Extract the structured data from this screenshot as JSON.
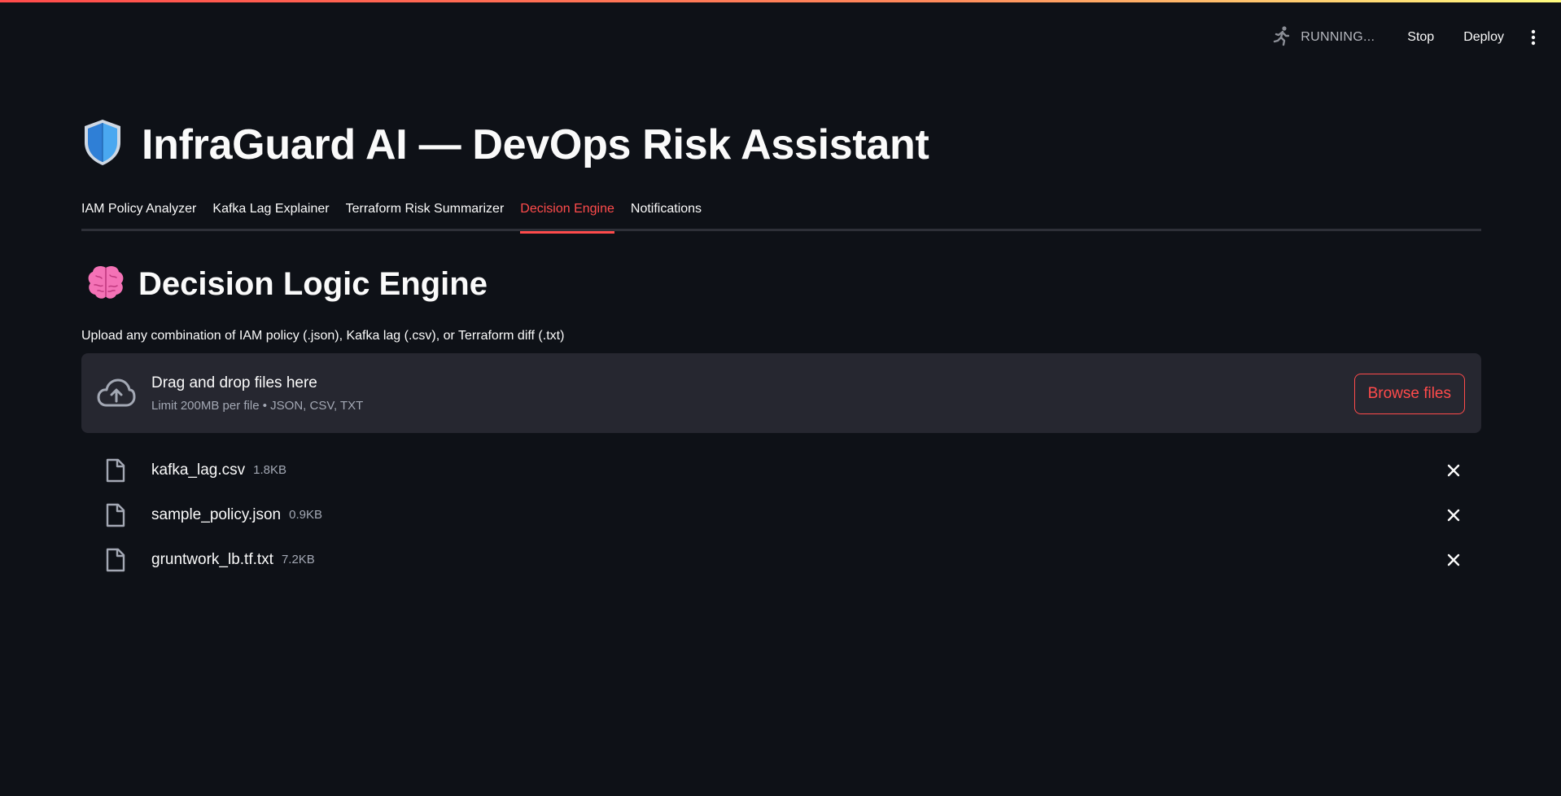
{
  "toolbar": {
    "status": "RUNNING...",
    "stop_label": "Stop",
    "deploy_label": "Deploy",
    "status_icon": "running-person-icon",
    "menu_icon": "vertical-dots-icon"
  },
  "app": {
    "title_icon": "shield-icon",
    "title": "InfraGuard AI — DevOps Risk Assistant"
  },
  "tabs": [
    {
      "label": "IAM Policy Analyzer",
      "active": false
    },
    {
      "label": "Kafka Lag Explainer",
      "active": false
    },
    {
      "label": "Terraform Risk Summarizer",
      "active": false
    },
    {
      "label": "Decision Engine",
      "active": true
    },
    {
      "label": "Notifications",
      "active": false
    }
  ],
  "section": {
    "icon": "brain-icon",
    "title": "Decision Logic Engine"
  },
  "uploader": {
    "label": "Upload any combination of IAM policy (.json), Kafka lag (.csv), or Terraform diff (.txt)",
    "drop_title": "Drag and drop files here",
    "limit_text": "Limit 200MB per file • JSON, CSV, TXT",
    "browse_label": "Browse files",
    "files": [
      {
        "name": "kafka_lag.csv",
        "size": "1.8KB"
      },
      {
        "name": "sample_policy.json",
        "size": "0.9KB"
      },
      {
        "name": "gruntwork_lb.tf.txt",
        "size": "7.2KB"
      }
    ]
  },
  "colors": {
    "background": "#0e1117",
    "accent": "#ff4b4b",
    "dropzone": "#262730",
    "muted_text": "#a3a8b4"
  }
}
